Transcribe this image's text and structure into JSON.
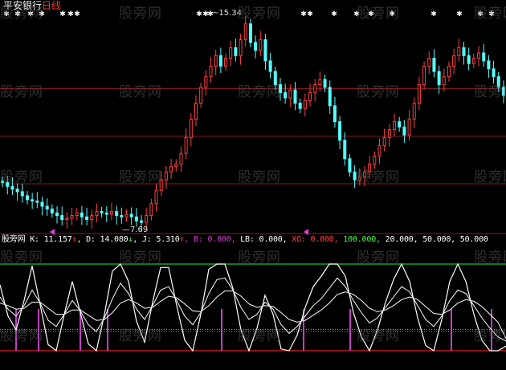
{
  "header": {
    "stock_name": "平安银行",
    "period": "日线"
  },
  "watermark": "股旁网",
  "price_labels": {
    "high": "15.34",
    "low": "7.69"
  },
  "indicator": {
    "name": "股旁网",
    "items": [
      {
        "text": "K: 11.157",
        "color": "#ffffff"
      },
      {
        "text": "↑",
        "color": "#ff4040"
      },
      {
        "text": ", D: 14.080",
        "color": "#ffffff"
      },
      {
        "text": "↓",
        "color": "#40ff40"
      },
      {
        "text": ", J: 5.310",
        "color": "#ffffff"
      },
      {
        "text": "↑",
        "color": "#ff4040"
      },
      {
        "text": ", B: 0.000,",
        "color": "#d040d0"
      },
      {
        "text": " LB: 0.000,",
        "color": "#ffffff"
      },
      {
        "text": " XG: 0.000,",
        "color": "#ff4040"
      },
      {
        "text": " 100.000,",
        "color": "#40ff40"
      },
      {
        "text": " 20.000, 50.000, 50.000",
        "color": "#ffffff"
      }
    ]
  },
  "colors": {
    "up": "#ff4040",
    "down": "#54ffff",
    "grid": "#8b1a1a",
    "ref_high": "#20c020",
    "ref_low": "#e02020",
    "signal": "#c040c0"
  },
  "chart_data": [
    {
      "type": "candlestick",
      "title": "",
      "ylim": [
        7.3,
        15.8
      ],
      "marked_high": 15.34,
      "marked_low": 7.69,
      "close": [
        9.2,
        9.05,
        8.95,
        8.85,
        8.7,
        8.55,
        8.5,
        8.45,
        8.3,
        8.2,
        8.05,
        7.95,
        7.8,
        7.85,
        7.95,
        8.05,
        7.9,
        7.8,
        7.95,
        8.1,
        8.05,
        8.0,
        8.1,
        7.95,
        7.9,
        8.0,
        7.9,
        7.75,
        7.69,
        7.95,
        8.4,
        8.9,
        9.3,
        9.6,
        9.8,
        9.9,
        10.3,
        10.9,
        11.6,
        12.2,
        12.8,
        13.2,
        13.6,
        14.0,
        13.6,
        13.9,
        14.3,
        14.0,
        14.6,
        15.2,
        14.5,
        14.2,
        14.6,
        13.8,
        13.4,
        12.9,
        12.6,
        12.4,
        12.7,
        12.2,
        12.0,
        12.3,
        12.6,
        12.9,
        13.1,
        12.8,
        12.1,
        11.5,
        10.8,
        10.1,
        9.6,
        9.3,
        9.4,
        9.6,
        9.9,
        10.2,
        10.6,
        10.9,
        11.2,
        11.5,
        11.3,
        11.0,
        11.6,
        12.2,
        12.9,
        13.6,
        13.9,
        13.4,
        12.9,
        13.2,
        13.6,
        14.0,
        14.3,
        14.0,
        13.7,
        13.9,
        14.1,
        13.8,
        13.5,
        13.2,
        12.8,
        12.5
      ]
    },
    {
      "type": "line",
      "title": "",
      "reference_lines": [
        100,
        50,
        20,
        0
      ],
      "series": [
        {
          "name": "K",
          "values": [
            62,
            48,
            40,
            52,
            70,
            55,
            35,
            28,
            42,
            58,
            46,
            30,
            22,
            38,
            60,
            78,
            66,
            48,
            36,
            52,
            70,
            74,
            58,
            40,
            30,
            44,
            66,
            82,
            84,
            70,
            50,
            36,
            42,
            56,
            48,
            30,
            20,
            28,
            40,
            52,
            60,
            72,
            84,
            74,
            58,
            44,
            32,
            38,
            50,
            62,
            74,
            68,
            52,
            36,
            28,
            40,
            58,
            70,
            66,
            52,
            38,
            26,
            16,
            11.157
          ]
        },
        {
          "name": "D",
          "values": [
            55,
            52,
            48,
            49,
            56,
            56,
            49,
            42,
            42,
            47,
            47,
            41,
            35,
            36,
            44,
            55,
            59,
            55,
            49,
            50,
            57,
            63,
            61,
            54,
            46,
            45,
            52,
            62,
            69,
            69,
            63,
            54,
            50,
            52,
            51,
            44,
            36,
            33,
            35,
            41,
            47,
            55,
            65,
            68,
            65,
            58,
            49,
            45,
            47,
            52,
            59,
            62,
            59,
            51,
            43,
            42,
            47,
            55,
            59,
            57,
            51,
            42,
            33,
            14.08
          ]
        },
        {
          "name": "J",
          "values": [
            76,
            40,
            24,
            58,
            98,
            53,
            7,
            0,
            42,
            80,
            44,
            8,
            0,
            42,
            92,
            100,
            80,
            34,
            10,
            56,
            96,
            96,
            52,
            12,
            0,
            42,
            94,
            100,
            100,
            72,
            24,
            0,
            26,
            64,
            42,
            2,
            0,
            18,
            50,
            74,
            86,
            100,
            100,
            86,
            44,
            16,
            0,
            24,
            56,
            82,
            100,
            80,
            38,
            6,
            0,
            36,
            80,
            100,
            80,
            42,
            12,
            0,
            0,
            5.31
          ]
        }
      ]
    }
  ]
}
